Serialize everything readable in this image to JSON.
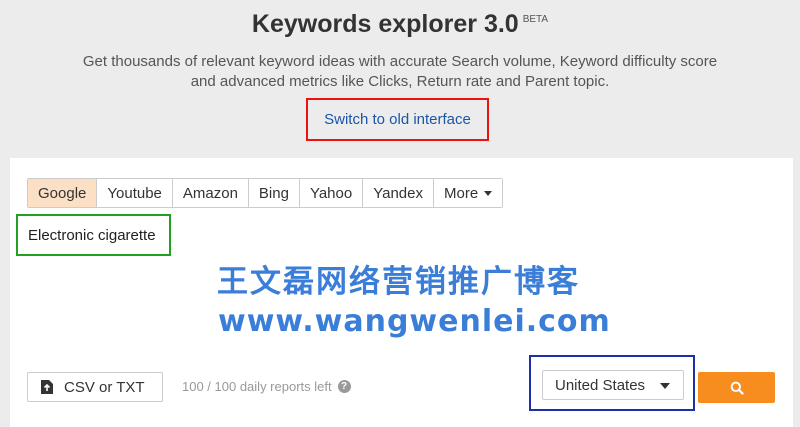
{
  "header": {
    "title": "Keywords explorer 3.0",
    "beta": "BETA",
    "subtitle": "Get thousands of relevant keyword ideas with accurate Search volume, Keyword difficulty score and advanced metrics like Clicks, Return rate and Parent topic.",
    "switch_link": "Switch to old interface"
  },
  "tabs": [
    {
      "label": "Google",
      "active": true
    },
    {
      "label": "Youtube"
    },
    {
      "label": "Amazon"
    },
    {
      "label": "Bing"
    },
    {
      "label": "Yahoo"
    },
    {
      "label": "Yandex"
    },
    {
      "label": "More"
    }
  ],
  "keyword_input": {
    "value": "Electronic cigarette"
  },
  "watermark": {
    "line1": "王文磊网络营销推广博客",
    "line2": "www.wangwenlei.com"
  },
  "footer": {
    "csv_button": "CSV or TXT",
    "reports_left": "100 / 100 daily reports left",
    "help_icon": "?",
    "country": "United States",
    "search_icon": "search-icon"
  },
  "colors": {
    "accent_orange": "#f78d1e",
    "active_tab_bg": "#fbe0c6",
    "link_blue": "#1c55a8",
    "highlight_red": "#e11111",
    "highlight_green": "#21a021",
    "highlight_blue": "#1b2fa6",
    "watermark_blue": "#3a7ed8"
  }
}
